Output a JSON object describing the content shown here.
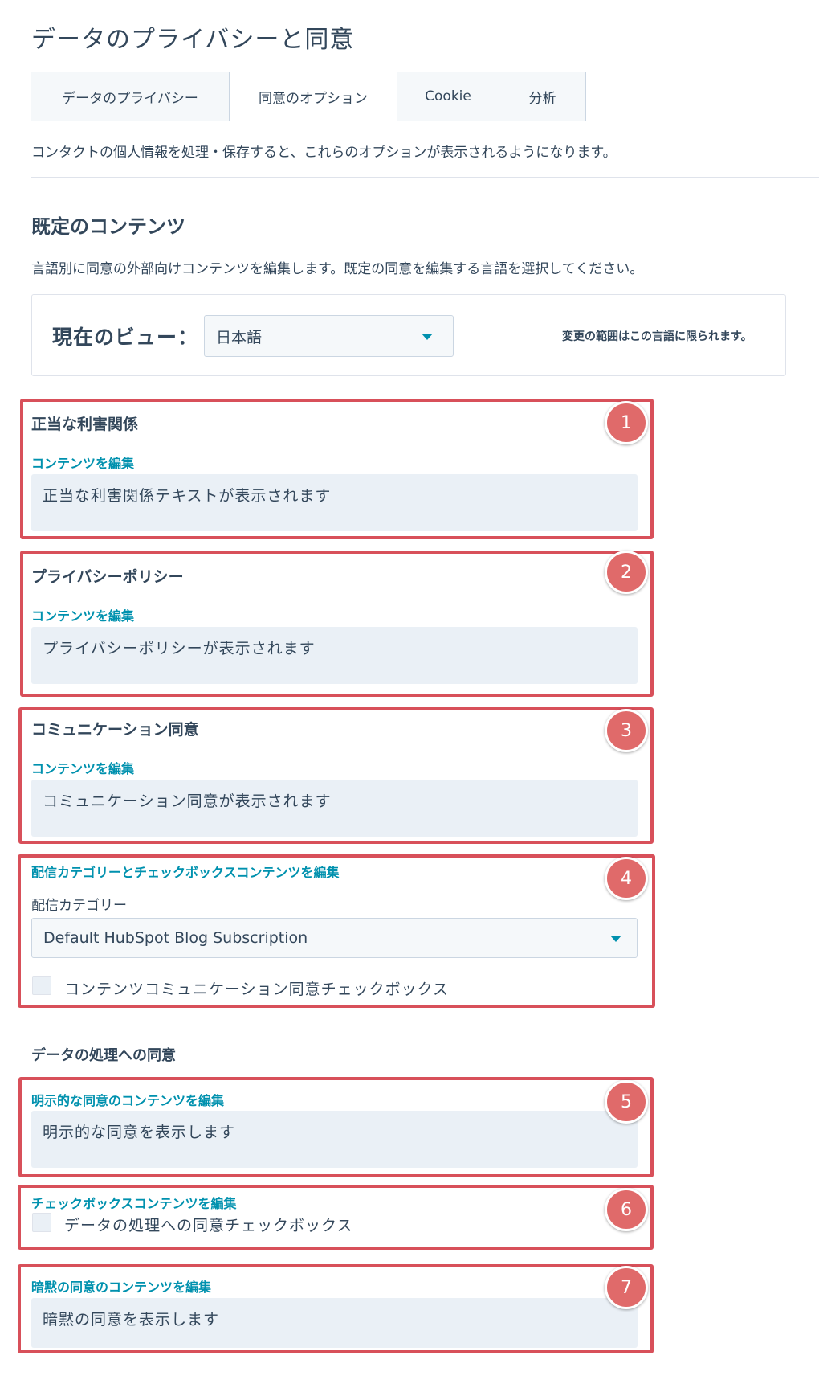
{
  "page_title": "データのプライバシーと同意",
  "tabs": [
    {
      "label": "データのプライバシー",
      "active": false
    },
    {
      "label": "同意のオプション",
      "active": true
    },
    {
      "label": "Cookie",
      "active": false
    },
    {
      "label": "分析",
      "active": false
    }
  ],
  "intro_text": "コンタクトの個人情報を処理・保存すると、これらのオプションが表示されるようになります。",
  "default_content": {
    "title": "既定のコンテンツ",
    "description": "言語別に同意の外部向けコンテンツを編集します。既定の同意を編集する言語を選択してください。",
    "view_label": "現在のビュー：",
    "language_selected": "日本語",
    "scope_note": "変更の範囲はこの言語に限られます。"
  },
  "sections": {
    "legitimate_interest": {
      "badge": "1",
      "heading": "正当な利害関係",
      "edit_link": "コンテンツを編集",
      "text": "正当な利害関係テキストが表示されます"
    },
    "privacy_policy": {
      "badge": "2",
      "heading": "プライバシーポリシー",
      "edit_link": "コンテンツを編集",
      "text": "プライバシーポリシーが表示されます"
    },
    "communication_consent": {
      "badge": "3",
      "heading": "コミュニケーション同意",
      "edit_link": "コンテンツを編集",
      "text": "コミュニケーション同意が表示されます"
    },
    "subscription": {
      "badge": "4",
      "edit_link": "配信カテゴリーとチェックボックスコンテンツを編集",
      "category_label": "配信カテゴリー",
      "category_selected": "Default HubSpot Blog Subscription",
      "checkbox_label": "コンテンツコミュニケーション同意チェックボックス",
      "checked": false
    },
    "data_processing_heading": "データの処理への同意",
    "explicit_consent": {
      "badge": "5",
      "edit_link": "明示的な同意のコンテンツを編集",
      "text": "明示的な同意を表示します"
    },
    "checkbox_content": {
      "badge": "6",
      "edit_link": "チェックボックスコンテンツを編集",
      "checkbox_label": "データの処理への同意チェックボックス",
      "checked": false
    },
    "implicit_consent": {
      "badge": "7",
      "edit_link": "暗黙の同意のコンテンツを編集",
      "text": "暗黙の同意を表示します"
    }
  },
  "colors": {
    "accent": "#0091ae",
    "annotation": "#d8505a",
    "text": "#33475b",
    "field_bg": "#eaf0f6"
  }
}
